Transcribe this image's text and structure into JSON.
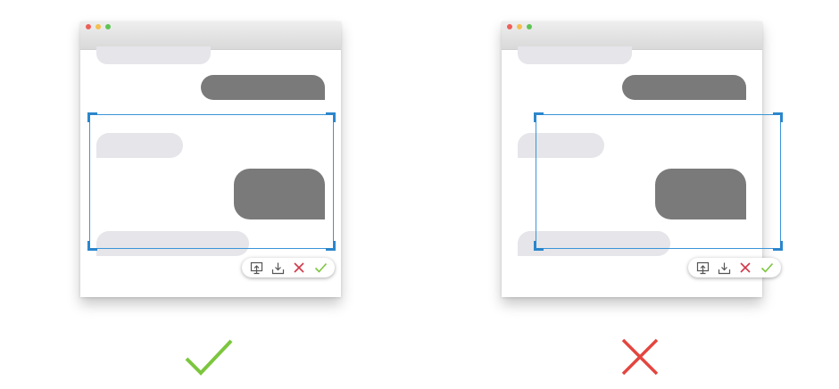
{
  "colors": {
    "selection": "#3a95d8",
    "incoming_bubble": "#e5e5ea",
    "outgoing_bubble": "#7a7a7a",
    "cancel": "#d0394a",
    "confirm": "#7cc63e"
  },
  "examples": [
    {
      "verdict": "correct",
      "verdict_icon": "check-mark-icon",
      "selection_within_window": true,
      "toolbar_icons": [
        "pin-to-screen-icon",
        "download-icon",
        "close-icon",
        "check-icon"
      ]
    },
    {
      "verdict": "incorrect",
      "verdict_icon": "x-mark-icon",
      "selection_within_window": false,
      "toolbar_icons": [
        "pin-to-screen-icon",
        "download-icon",
        "close-icon",
        "check-icon"
      ]
    }
  ]
}
